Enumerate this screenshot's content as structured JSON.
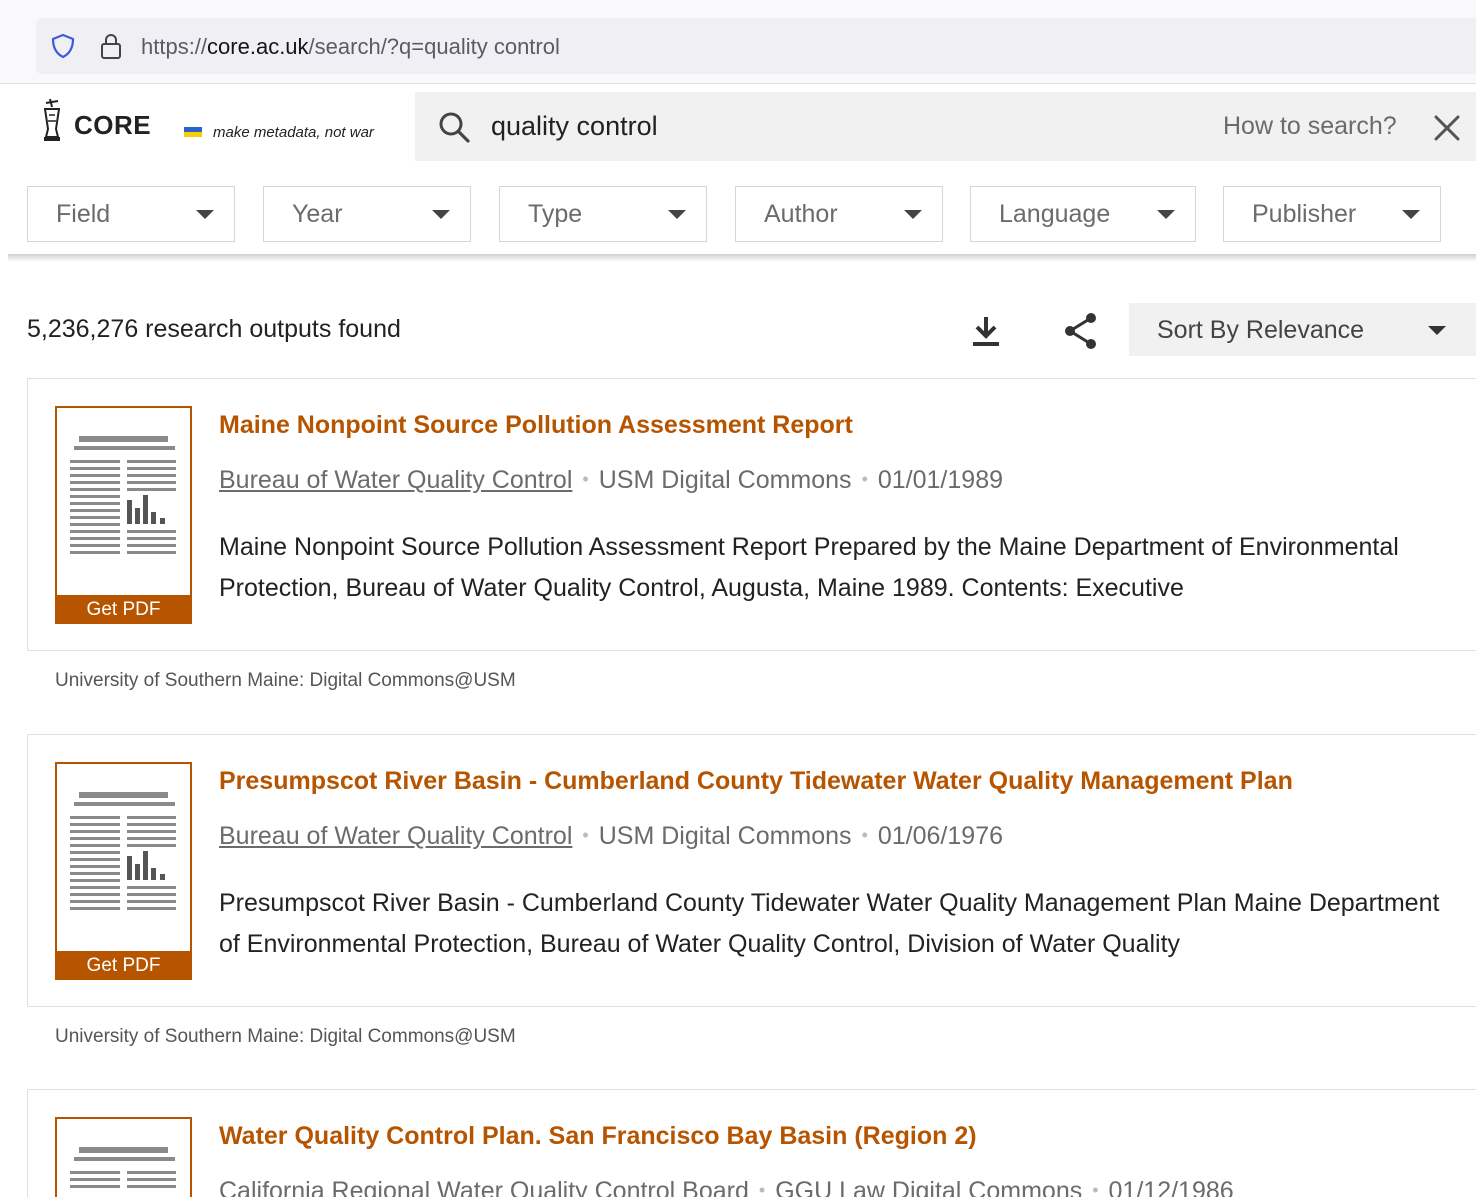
{
  "browser": {
    "url_prefix": "https://",
    "url_host": "core.ac.uk",
    "url_path": "/search/?q=quality control"
  },
  "header": {
    "logo_text": "CORE",
    "slogan": "make metadata, not war",
    "search_value": "quality control",
    "how_to_search": "How to search?"
  },
  "filters": [
    {
      "label": "Field"
    },
    {
      "label": "Year"
    },
    {
      "label": "Type"
    },
    {
      "label": "Author"
    },
    {
      "label": "Language"
    },
    {
      "label": "Publisher"
    }
  ],
  "results": {
    "count_text": "5,236,276 research outputs found",
    "sort_label": "Sort By Relevance",
    "items": [
      {
        "title": "Maine Nonpoint Source Pollution Assessment Report",
        "author": "Bureau of Water Quality Control",
        "repository": "USM Digital Commons",
        "date": "01/01/1989",
        "abstract": "Maine Nonpoint Source Pollution Assessment Report Prepared by the Maine Department of Environmental Protection, Bureau of Water Quality Control, Augusta, Maine 1989. Contents: Executive",
        "get_pdf": "Get PDF",
        "provider": "University of Southern Maine: Digital Commons@USM"
      },
      {
        "title": "Presumpscot River Basin - Cumberland County Tidewater Water Quality Management Plan",
        "author": "Bureau of Water Quality Control",
        "repository": "USM Digital Commons",
        "date": "01/06/1976",
        "abstract": "Presumpscot River Basin - Cumberland County Tidewater Water Quality Management Plan Maine Department of Environmental Protection, Bureau of Water Quality Control, Division of Water Quality",
        "get_pdf": "Get PDF",
        "provider": "University of Southern Maine: Digital Commons@USM"
      },
      {
        "title": "Water Quality Control Plan. San Francisco Bay Basin (Region 2)",
        "author": "California Regional Water Quality Control Board",
        "repository": "GGU Law Digital Commons",
        "date": "01/12/1986"
      }
    ]
  },
  "colors": {
    "accent": "#b75400",
    "search_bg": "#f1f1f1",
    "flag_blue": "#2f62c8",
    "flag_yellow": "#f5d000"
  },
  "icons": [
    "shield-icon",
    "lock-icon",
    "core-logo-icon",
    "search-icon",
    "close-icon",
    "download-icon",
    "share-icon",
    "document-thumbnail-icon"
  ]
}
